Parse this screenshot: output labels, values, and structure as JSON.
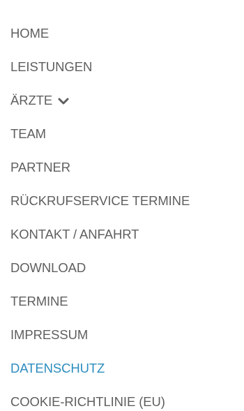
{
  "menu": {
    "items": [
      {
        "label": "HOME"
      },
      {
        "label": "LEISTUNGEN"
      },
      {
        "label": "ÄRZTE",
        "has_dropdown": true
      },
      {
        "label": "TEAM"
      },
      {
        "label": "PARTNER"
      },
      {
        "label": "RÜCKRUFSERVICE TERMINE"
      },
      {
        "label": "KONTAKT / ANFAHRT"
      },
      {
        "label": "DOWNLOAD"
      },
      {
        "label": "TERMINE"
      },
      {
        "label": "IMPRESSUM"
      },
      {
        "label": "DATENSCHUTZ",
        "active": true
      },
      {
        "label": "COOKIE-RICHTLINIE (EU)"
      }
    ]
  },
  "colors": {
    "text": "#5f5f5f",
    "active": "#2c8dc0",
    "background": "#ffffff"
  },
  "icons": {
    "dropdown": "chevron-down-icon"
  }
}
